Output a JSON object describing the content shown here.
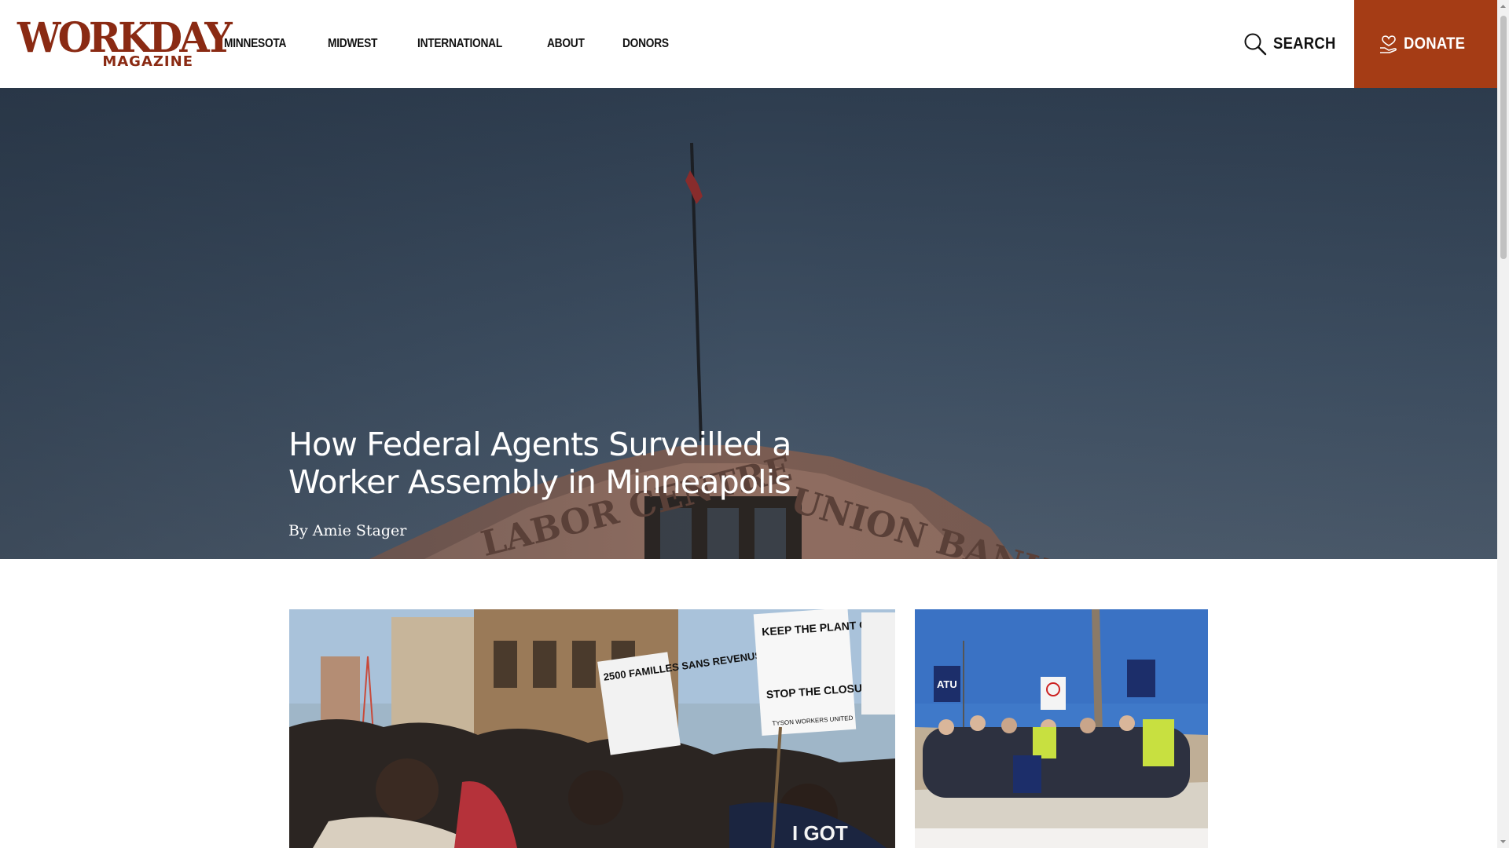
{
  "brand": {
    "logo_main": "WORKDAY",
    "logo_sub": "MAGAZINE",
    "color": "#8a2a13"
  },
  "nav": {
    "items": [
      {
        "label": "MINNESOTA"
      },
      {
        "label": "MIDWEST"
      },
      {
        "label": "INTERNATIONAL"
      },
      {
        "label": "ABOUT"
      },
      {
        "label": "DONORS"
      }
    ]
  },
  "header": {
    "search_label": "SEARCH",
    "search_icon": "search-icon",
    "donate_label": "DONATE",
    "donate_icon": "heart-hand-icon",
    "donate_color": "#a53c15"
  },
  "hero": {
    "title": "How Federal Agents Surveilled a Worker Assembly in Minneapolis",
    "byline_prefix": "By ",
    "author": "Amie Stager",
    "building_sign_left": "LABOR CENTRE",
    "building_sign_right": "UNION BANK"
  },
  "cards": {
    "big": {
      "signs": {
        "keep_plant_open": "KEEP THE PLANT OPEN!",
        "stop_closure": "STOP THE CLOSURE!",
        "tyson": "TYSON WORKERS UNITED",
        "families": "2500 FAMILLES SANS REVENUS",
        "shirt": "I GOT"
      }
    },
    "small": {
      "sign_text": "ATU"
    }
  }
}
